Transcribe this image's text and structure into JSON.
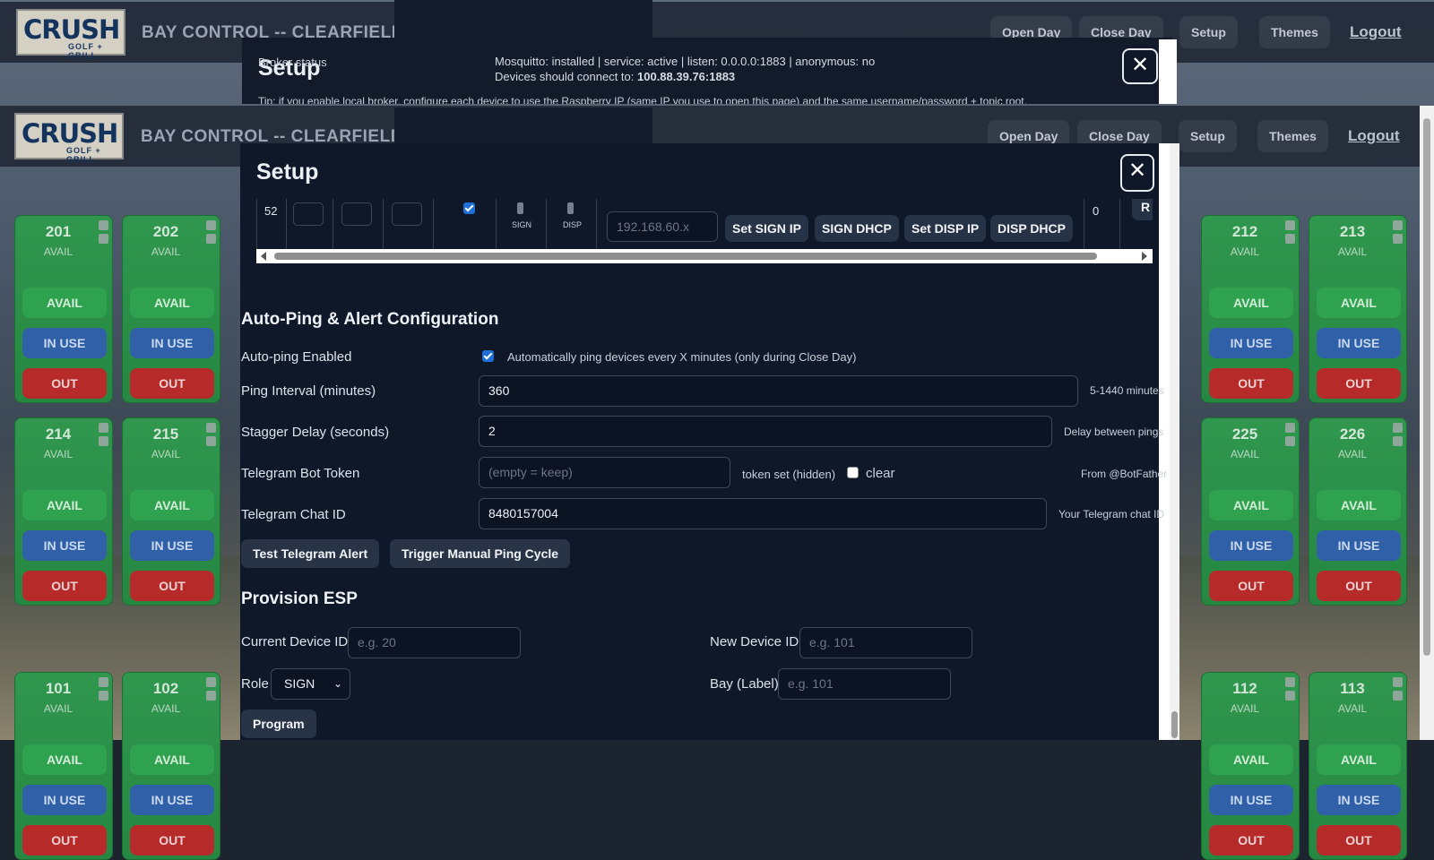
{
  "app": {
    "logo_main": "CRUSH",
    "logo_sub": "GOLF + GRILL",
    "title": "BAY CONTROL -- CLEARFIELD --"
  },
  "nav": {
    "open_day": "Open Day",
    "close_day": "Close Day",
    "setup": "Setup",
    "themes": "Themes",
    "logout": "Logout"
  },
  "modal_top": {
    "title": "Setup",
    "broker_label": "Broker status",
    "broker_status": "Mosquitto: installed | service: active | listen: 0.0.0.0:1883 | anonymous: no",
    "connect_prefix": "Devices should connect to:",
    "connect_address": "100.88.39.76:1883",
    "tip": "Tip: if you enable local broker, configure each device to use the Raspberry IP (same IP you use to open this page) and the same username/password + topic root."
  },
  "bay_buttons": {
    "avail": "AVAIL",
    "in_use": "IN USE",
    "out": "OUT"
  },
  "bays": [
    {
      "num": "201",
      "state": "AVAIL"
    },
    {
      "num": "202",
      "state": "AVAIL"
    },
    {
      "num": "212",
      "state": "AVAIL"
    },
    {
      "num": "213",
      "state": "AVAIL"
    },
    {
      "num": "214",
      "state": "AVAIL"
    },
    {
      "num": "215",
      "state": "AVAIL"
    },
    {
      "num": "225",
      "state": "AVAIL"
    },
    {
      "num": "226",
      "state": "AVAIL"
    },
    {
      "num": "101",
      "state": "AVAIL"
    },
    {
      "num": "102",
      "state": "AVAIL"
    },
    {
      "num": "112",
      "state": "AVAIL"
    },
    {
      "num": "113",
      "state": "AVAIL"
    }
  ],
  "modal": {
    "title": "Setup",
    "close_glyph": "✕",
    "device_row": {
      "id": "52",
      "sign_label": "SIGN",
      "disp_label": "DISP",
      "ip_placeholder": "192.168.60.x",
      "set_sign_ip": "Set SIGN IP",
      "sign_dhcp": "SIGN DHCP",
      "set_disp_ip": "Set DISP IP",
      "disp_dhcp": "DISP DHCP",
      "count": "0",
      "cut_button": "R"
    },
    "autoping": {
      "heading": "Auto-Ping & Alert Configuration",
      "enabled_label": "Auto-ping Enabled",
      "enabled_hint": "Automatically ping devices every X minutes (only during Close Day)",
      "interval_label": "Ping Interval (minutes)",
      "interval_value": "360",
      "interval_hint": "5-1440 minutes",
      "stagger_label": "Stagger Delay (seconds)",
      "stagger_value": "2",
      "stagger_hint": "Delay between pings",
      "token_label": "Telegram Bot Token",
      "token_placeholder": "(empty = keep)",
      "token_status": "token set (hidden)",
      "clear_label": "clear",
      "token_hint": "From @BotFather",
      "chat_label": "Telegram Chat ID",
      "chat_value": "8480157004",
      "chat_hint": "Your Telegram chat ID",
      "test_btn": "Test Telegram Alert",
      "trigger_btn": "Trigger Manual Ping Cycle"
    },
    "provision": {
      "heading": "Provision ESP",
      "current_label": "Current Device ID",
      "current_placeholder": "e.g. 20",
      "new_label": "New Device ID",
      "new_placeholder": "e.g. 101",
      "role_label": "Role",
      "role_value": "SIGN",
      "bay_label": "Bay (Label)",
      "bay_placeholder": "e.g. 101",
      "program_btn": "Program"
    }
  },
  "colors": {
    "accent_green": "#2fa24f",
    "accent_blue": "#2f60a8",
    "accent_red": "#b62a2a",
    "modal_bg": "#0f1829"
  }
}
